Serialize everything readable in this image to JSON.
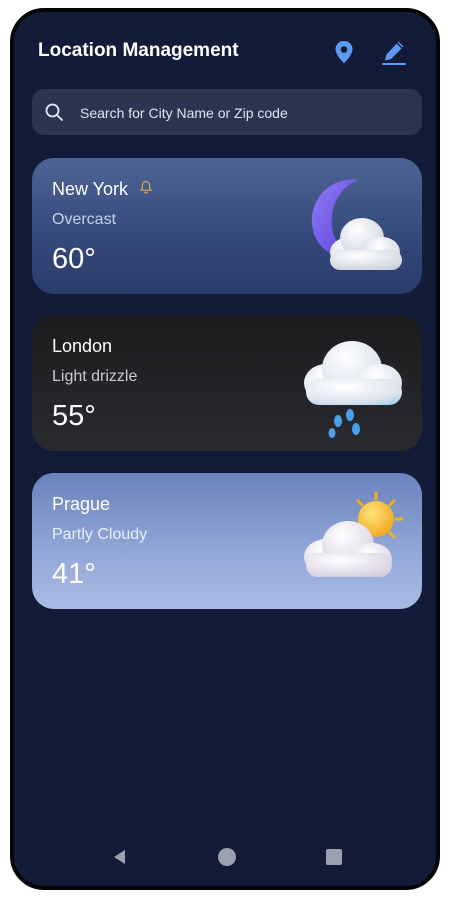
{
  "header": {
    "title": "Location Management",
    "location_icon": "map-pin-icon",
    "edit_icon": "pencil-icon"
  },
  "search": {
    "placeholder": "Search for City Name or Zip code",
    "icon": "search-icon"
  },
  "locations": [
    {
      "city": "New York",
      "condition": "Overcast",
      "temp": "60°",
      "icon": "moon-cloud-icon",
      "current_marker_icon": "bell-icon"
    },
    {
      "city": "London",
      "condition": "Light drizzle",
      "temp": "55°",
      "icon": "rain-cloud-icon"
    },
    {
      "city": "Prague",
      "condition": "Partly Cloudy",
      "temp": "41°",
      "icon": "sun-cloud-icon"
    }
  ],
  "navbar": {
    "back_icon": "back-triangle-icon",
    "home_icon": "home-circle-icon",
    "recents_icon": "recents-square-icon"
  },
  "colors": {
    "background": "#121c39",
    "search_bg": "#2a3552",
    "accent": "#5b9cf2"
  }
}
